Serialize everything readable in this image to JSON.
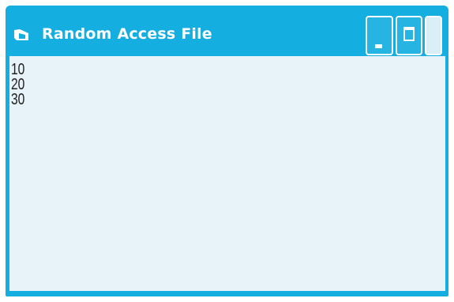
{
  "window": {
    "title": "Random Access File",
    "icon": "window-app-icon",
    "accent_color": "#14aee0",
    "client_background": "#e7f3f8",
    "controls": {
      "minimize": "minimize-icon",
      "maximize": "maximize-icon",
      "close": "close-icon"
    }
  },
  "output": {
    "lines": [
      "10",
      "20",
      "30"
    ]
  }
}
